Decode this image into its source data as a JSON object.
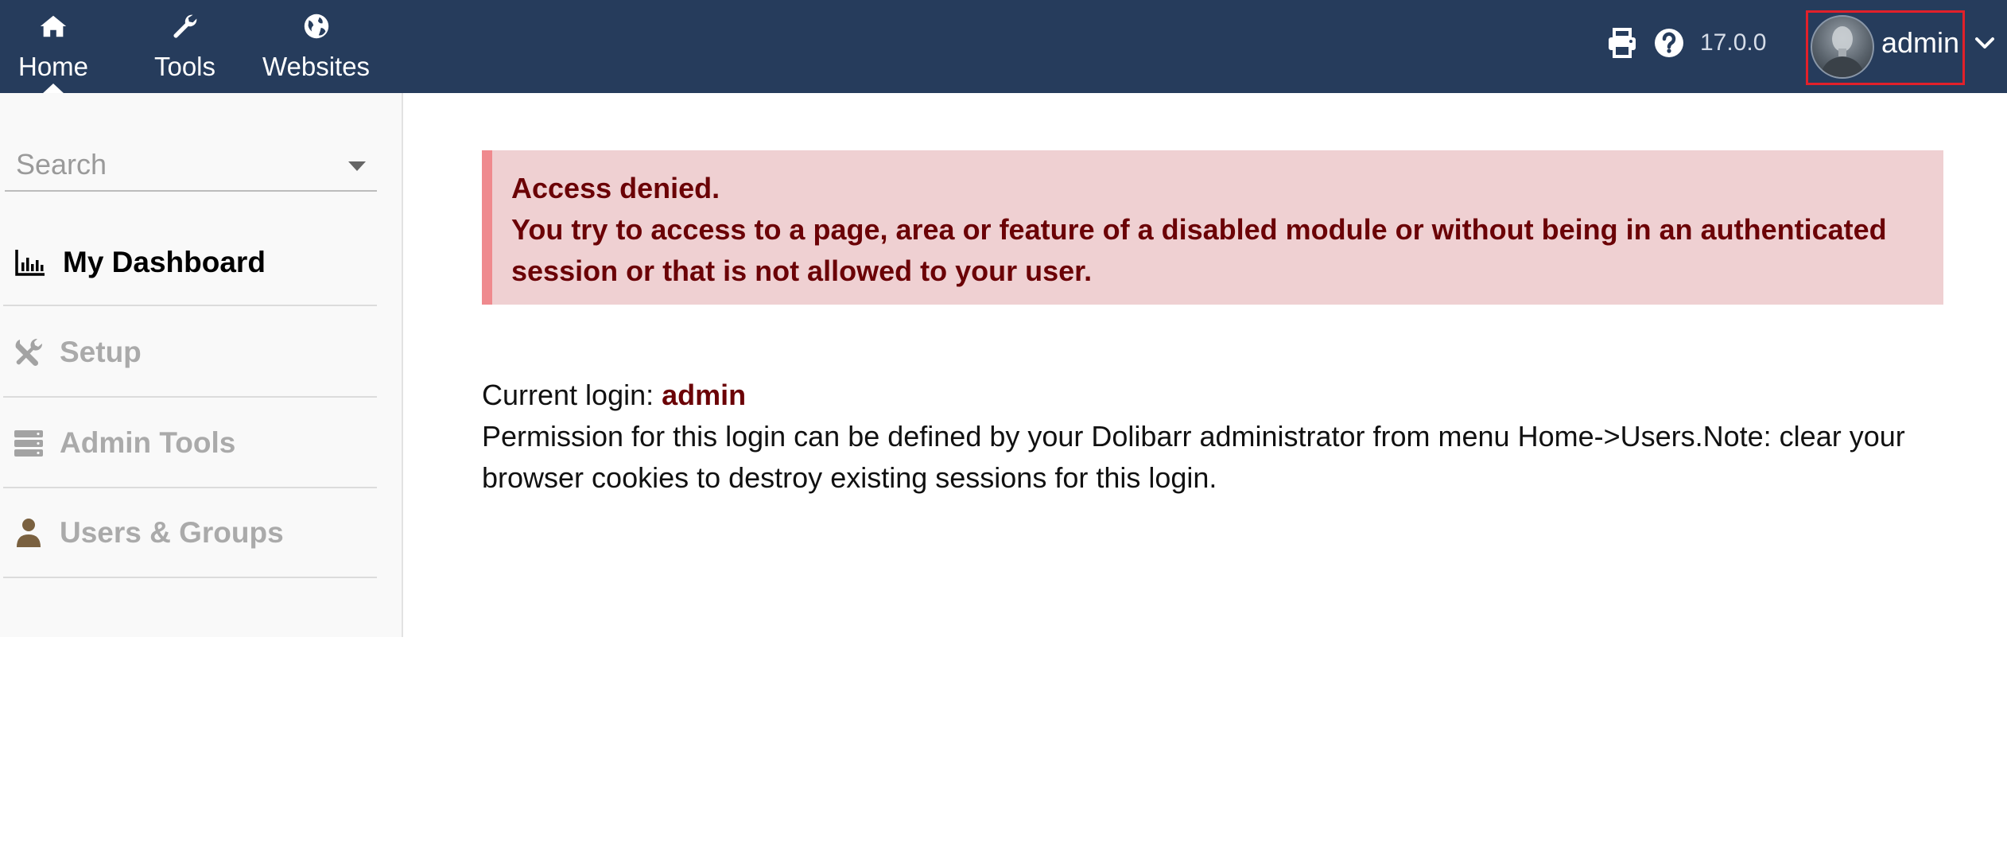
{
  "topbar": {
    "nav": [
      {
        "label": "Home",
        "icon": "home-icon"
      },
      {
        "label": "Tools",
        "icon": "wrench-icon"
      },
      {
        "label": "Websites",
        "icon": "globe-icon"
      }
    ],
    "version": "17.0.0",
    "user": {
      "name": "admin"
    },
    "colors": {
      "background": "#263c5c",
      "highlight_border": "#e2202a"
    }
  },
  "sidebar": {
    "search": {
      "placeholder": "Search"
    },
    "items": [
      {
        "label": "My Dashboard",
        "icon": "chart-bar-icon",
        "active": true
      },
      {
        "label": "Setup",
        "icon": "tools-icon",
        "active": false
      },
      {
        "label": "Admin Tools",
        "icon": "server-icon",
        "active": false
      },
      {
        "label": "Users & Groups",
        "icon": "user-icon",
        "active": false
      }
    ]
  },
  "main": {
    "error": {
      "title": "Access denied.",
      "message": "You try to access to a page, area or feature of a disabled module or without being in an authenticated session or that is not allowed to your user."
    },
    "login": {
      "label": "Current login: ",
      "name": "admin",
      "note": "Permission for this login can be defined by your Dolibarr administrator from menu Home->Users.Note: clear your browser cookies to destroy existing sessions for this login."
    },
    "colors": {
      "error_bg": "#efd0d2",
      "error_text": "#6b0206",
      "error_border": "#ef8a8e"
    }
  }
}
